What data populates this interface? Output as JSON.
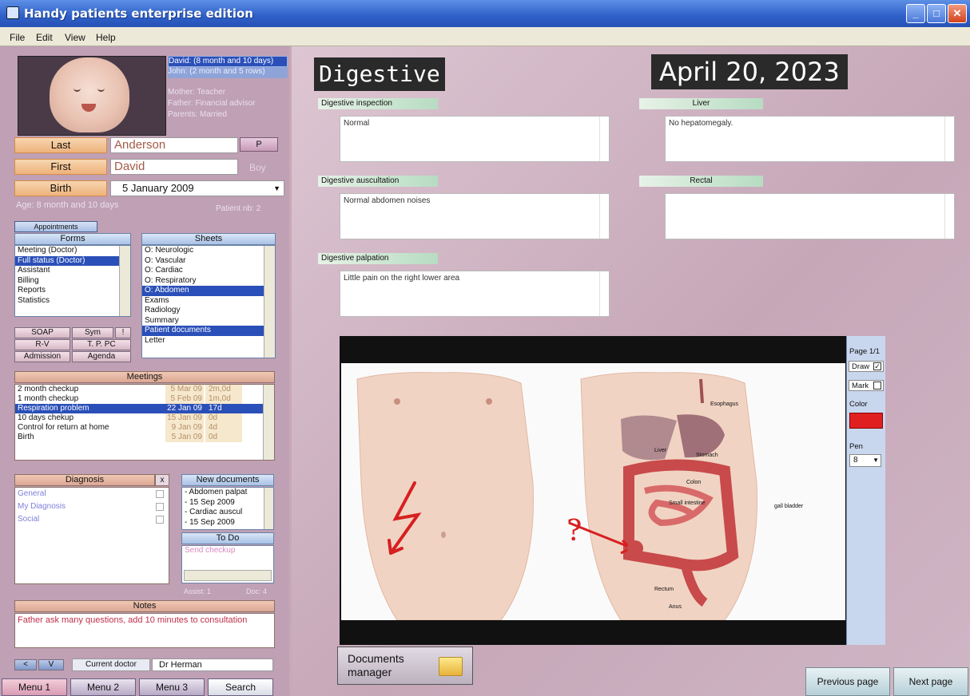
{
  "window": {
    "title": "Handy patients enterprise edition",
    "minimize_icon": "minimize-icon",
    "maximize_icon": "maximize-icon",
    "close_icon": "close-icon"
  },
  "menubar": {
    "items": [
      "File",
      "Edit",
      "View",
      "Help"
    ]
  },
  "patient": {
    "family_lines": [
      "David: (8 month and 10 days)",
      "John: (2 month and 5 rows)",
      "Mother: Teacher",
      "Father: Financial advisor",
      "Parents: Married"
    ],
    "last_label": "Last",
    "last_value": "Anderson",
    "p_button": "P",
    "first_label": "First",
    "first_value": "David",
    "sex": "Boy",
    "birth_label": "Birth",
    "birth_value": "5  January  2009",
    "age": "Age: 8 month and 10 days",
    "patient_nb": "Patient nb: 2"
  },
  "appointments_button": "Appointments",
  "forms": {
    "header": "Forms",
    "items": [
      "Meeting (Doctor)",
      "Full status (Doctor)",
      "Assistant",
      "Billing",
      "Reports",
      "Statistics"
    ],
    "selected": 1
  },
  "sheets": {
    "header": "Sheets",
    "items": [
      "O: Neurologic",
      "O: Vascular",
      "O: Cardiac",
      "O: Respiratory",
      "O: Abdomen",
      "Exams",
      "Radiology",
      "Summary",
      "Patient documents",
      "Letter"
    ],
    "selected": [
      4,
      8
    ]
  },
  "grid_buttons": [
    "SOAP",
    "Sym",
    "!",
    "R-V",
    "T. P. PC",
    "Admission",
    "Agenda"
  ],
  "meetings": {
    "header": "Meetings",
    "rows": [
      {
        "name": "2 month checkup",
        "date": "5 Mar 09",
        "age": "2m,0d"
      },
      {
        "name": "1 month checkup",
        "date": "5 Feb 09",
        "age": "1m,0d"
      },
      {
        "name": "Respiration problem",
        "date": "22 Jan 09",
        "age": "17d"
      },
      {
        "name": "10 days chekup",
        "date": "15 Jan 09",
        "age": "0d"
      },
      {
        "name": "Control for return at home",
        "date": "9 Jan 09",
        "age": "4d"
      },
      {
        "name": "Birth",
        "date": "5 Jan 09",
        "age": "0d"
      }
    ],
    "selected": 2
  },
  "diagnosis": {
    "header": "Diagnosis",
    "close": "x",
    "items": [
      "General",
      "My Diagnosis",
      "Social"
    ]
  },
  "new_documents": {
    "header": "New documents",
    "items": [
      "- Abdomen palpat",
      "- 15 Sep 2009",
      "- Cardiac auscul",
      "- 15 Sep 2009"
    ]
  },
  "todo": {
    "header": "To Do",
    "items": [
      "Send checkup"
    ]
  },
  "small_labels": {
    "assist": "Assist: 1",
    "doc": "Doc: 4"
  },
  "notes": {
    "header": "Notes",
    "text": "Father ask many questions, add 10 minutes to consultation"
  },
  "current_doctor": {
    "label": "Current doctor",
    "value": "Dr Herman",
    "btn1": "<",
    "btn2": "V"
  },
  "bottom_tabs": [
    "Menu 1",
    "Menu 2",
    "Menu 3",
    "Search"
  ],
  "main": {
    "heading": "Digestive",
    "date": "April 20, 2023",
    "sections": [
      {
        "label": "Digestive inspection",
        "text": "Normal"
      },
      {
        "label": "Liver",
        "text": "No hepatomegaly."
      },
      {
        "label": "Digestive auscultation",
        "text": "Normal abdomen noises"
      },
      {
        "label": "Rectal",
        "text": ""
      },
      {
        "label": "Digestive palpation",
        "text": "Little pain on the right lower area"
      }
    ],
    "anatomy_labels": [
      "Esophagus",
      "Liver",
      "Stomach",
      "Colon",
      "Small intestine",
      "gall bladder",
      "Rectum",
      "Anus"
    ],
    "question_mark": "?",
    "tools": {
      "page": "Page 1/1",
      "draw": "Draw",
      "mark": "Mark",
      "color_label": "Color",
      "pen_label": "Pen",
      "pen_value": "8",
      "pen_color": "#e02020"
    },
    "documents_manager": "Documents manager",
    "prev_page": "Previous page",
    "next_page": "Next page"
  }
}
